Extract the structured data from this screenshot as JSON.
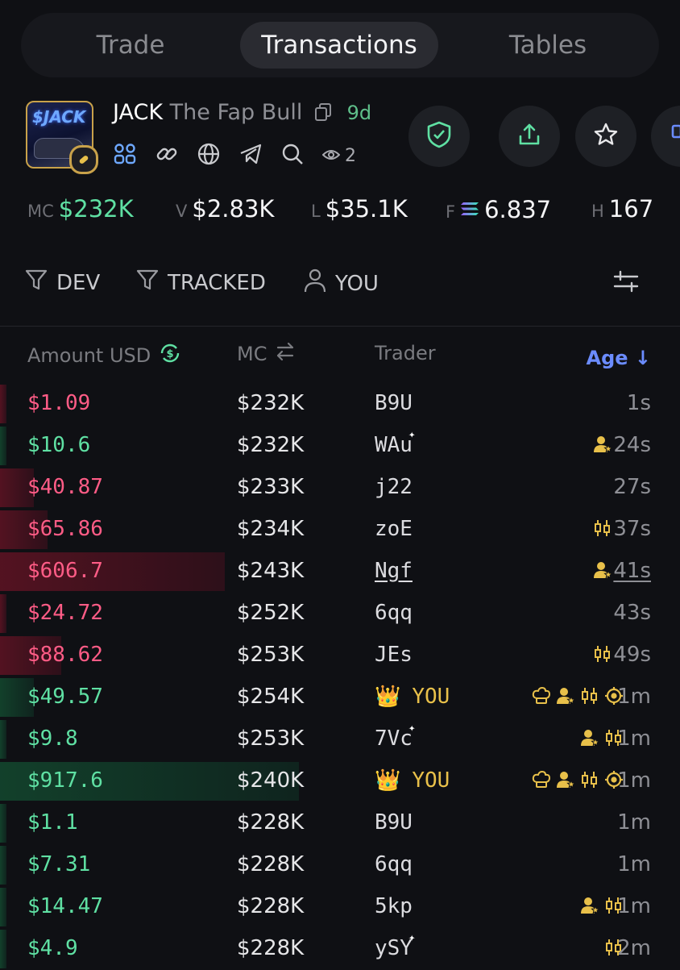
{
  "tabs": [
    {
      "label": "Trade"
    },
    {
      "label": "Transactions"
    },
    {
      "label": "Tables"
    }
  ],
  "token": {
    "symbol": "JACK",
    "name": "The Fap Bull",
    "age": "9d",
    "image_text": "$JACK",
    "viewers": "2",
    "icons": [
      "community-icon",
      "link-icon",
      "website-icon",
      "telegram-icon",
      "search-icon",
      "eye-icon"
    ]
  },
  "actions": [
    "shield-check-icon",
    "share-icon",
    "star-icon",
    "pin-icon"
  ],
  "stats": {
    "mc_label": "MC",
    "mc_value": "$232K",
    "v_label": "V",
    "v_value": "$2.83K",
    "l_label": "L",
    "l_value": "$35.1K",
    "f_label": "F",
    "f_value": "6.837",
    "h_label": "H",
    "h_value": "167"
  },
  "filters": {
    "dev": "DEV",
    "tracked": "TRACKED",
    "you": "YOU"
  },
  "table": {
    "headers": {
      "amount": "Amount USD",
      "mc": "MC",
      "trader": "Trader",
      "age": "Age ↓"
    },
    "rows": [
      {
        "amount": "$1.09",
        "side": "sell",
        "mc": "$232K",
        "trader": "B9U",
        "age": "1s",
        "bar": 0.01,
        "tags": [],
        "sparkle": false
      },
      {
        "amount": "$10.6",
        "side": "buy",
        "mc": "$232K",
        "trader": "WAu",
        "age": "24s",
        "bar": 0.01,
        "tags": [
          "insider"
        ],
        "sparkle": true
      },
      {
        "amount": "$40.87",
        "side": "sell",
        "mc": "$233K",
        "trader": "j22",
        "age": "27s",
        "bar": 0.05,
        "tags": [],
        "sparkle": false
      },
      {
        "amount": "$65.86",
        "side": "sell",
        "mc": "$234K",
        "trader": "zoE",
        "age": "37s",
        "bar": 0.07,
        "tags": [
          "candles"
        ],
        "sparkle": false
      },
      {
        "amount": "$606.7",
        "side": "sell",
        "mc": "$243K",
        "trader": "Ngf",
        "age": "41s",
        "bar": 0.33,
        "tags": [
          "insider"
        ],
        "sparkle": false,
        "underline": true
      },
      {
        "amount": "$24.72",
        "side": "sell",
        "mc": "$252K",
        "trader": "6qq",
        "age": "43s",
        "bar": 0.01,
        "tags": [],
        "sparkle": false
      },
      {
        "amount": "$88.62",
        "side": "sell",
        "mc": "$253K",
        "trader": "JEs",
        "age": "49s",
        "bar": 0.09,
        "tags": [
          "candles"
        ],
        "sparkle": false
      },
      {
        "amount": "$49.57",
        "side": "buy",
        "mc": "$254K",
        "trader": "YOU",
        "age": "1m",
        "bar": 0.05,
        "tags": [
          "chef",
          "insider",
          "candles",
          "target"
        ],
        "sparkle": false,
        "you": true
      },
      {
        "amount": "$9.8",
        "side": "buy",
        "mc": "$253K",
        "trader": "7Vc",
        "age": "1m",
        "bar": 0.01,
        "tags": [
          "insider",
          "candles"
        ],
        "sparkle": true
      },
      {
        "amount": "$917.6",
        "side": "buy",
        "mc": "$240K",
        "trader": "YOU",
        "age": "1m",
        "bar": 0.44,
        "tags": [
          "chef",
          "insider",
          "candles",
          "target"
        ],
        "sparkle": false,
        "you": true
      },
      {
        "amount": "$1.1",
        "side": "buy",
        "mc": "$228K",
        "trader": "B9U",
        "age": "1m",
        "bar": 0.01,
        "tags": [],
        "sparkle": false
      },
      {
        "amount": "$7.31",
        "side": "buy",
        "mc": "$228K",
        "trader": "6qq",
        "age": "1m",
        "bar": 0.01,
        "tags": [],
        "sparkle": false
      },
      {
        "amount": "$14.47",
        "side": "buy",
        "mc": "$228K",
        "trader": "5kp",
        "age": "1m",
        "bar": 0.01,
        "tags": [
          "insider",
          "candles"
        ],
        "sparkle": false
      },
      {
        "amount": "$4.9",
        "side": "buy",
        "mc": "$228K",
        "trader": "ySY",
        "age": "2m",
        "bar": 0.01,
        "tags": [
          "candles"
        ],
        "sparkle": true
      }
    ]
  },
  "colors": {
    "buy": "#5fe0a3",
    "sell": "#ff5c86",
    "accent": "#6b8cff",
    "gold": "#e8c04a"
  }
}
